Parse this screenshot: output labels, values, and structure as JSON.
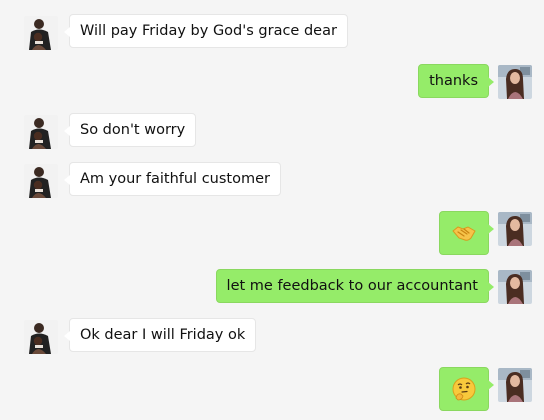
{
  "messages": [
    {
      "side": "in",
      "text": "Will pay Friday  by God's grace dear"
    },
    {
      "side": "out",
      "text": "thanks"
    },
    {
      "side": "in",
      "text": "So don't worry"
    },
    {
      "side": "in",
      "text": "Am your faithful customer"
    },
    {
      "side": "out",
      "emoji": "handshake-emoji"
    },
    {
      "side": "out",
      "text": "let me feedback to our accountant"
    },
    {
      "side": "in",
      "text": "Ok dear I will Friday ok"
    },
    {
      "side": "out",
      "emoji": "thinking-face-emoji"
    }
  ],
  "colors": {
    "background": "#f5f5f5",
    "incoming_bubble": "#ffffff",
    "outgoing_bubble": "#95ec69"
  }
}
